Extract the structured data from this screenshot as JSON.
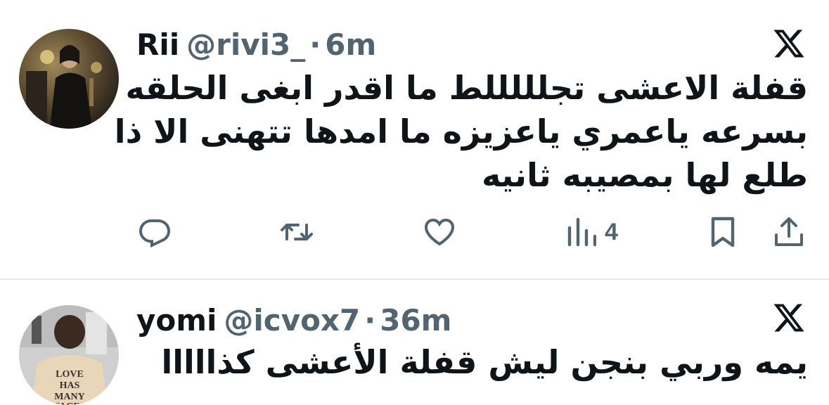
{
  "tweets": [
    {
      "name": "Rii",
      "handle": "@rivi3_",
      "separator": "·",
      "time": "6m",
      "text_lines": [
        "قفلة الاعشى تجلللللط ما اقدر ابغى الحلقه",
        "بسرعه ياعمري ياعزيزه ما امدها تتهنى الا ذا",
        "طلع لها بمصيبه ثانيه"
      ],
      "actions": {
        "reply_icon": "reply-icon",
        "retweet_icon": "retweet-icon",
        "like_icon": "heart-icon",
        "views_icon": "views-chart-icon",
        "views_count": "4",
        "bookmark_icon": "bookmark-icon",
        "share_icon": "share-icon"
      }
    },
    {
      "name": "yomi",
      "handle": "@icvox7",
      "separator": "·",
      "time": "36m",
      "text_lines": [
        "يمه وربي بنجن ليش قفلة الأعشى كذااااا"
      ],
      "avatar_shirt_text": "LOVE HAS MANY FACES"
    }
  ],
  "colors": {
    "text_primary": "#0f1419",
    "text_secondary": "#536471",
    "divider": "#e6e9ec"
  }
}
